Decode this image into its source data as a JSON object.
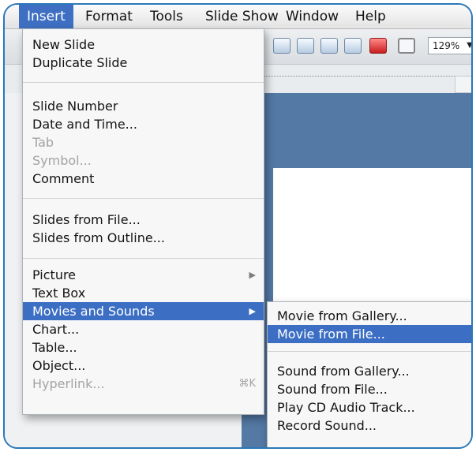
{
  "menubar": {
    "items": [
      "Insert",
      "Format",
      "Tools",
      "Slide Show",
      "Window",
      "Help"
    ]
  },
  "toolbar": {
    "zoom": "129%",
    "icons": [
      "table-icon",
      "chart-icon",
      "image-icon",
      "media-icon",
      "toolbox-icon",
      "textbox-icon"
    ]
  },
  "insert_menu": {
    "items": [
      {
        "label": "New Slide",
        "enabled": true
      },
      {
        "label": "Duplicate Slide",
        "enabled": true
      },
      {
        "label": "Slide Number",
        "enabled": true
      },
      {
        "label": "Date and Time...",
        "enabled": true
      },
      {
        "label": "Tab",
        "enabled": false
      },
      {
        "label": "Symbol...",
        "enabled": false
      },
      {
        "label": "Comment",
        "enabled": true
      },
      {
        "label": "Slides from File...",
        "enabled": true
      },
      {
        "label": "Slides from Outline...",
        "enabled": true
      },
      {
        "label": "Picture",
        "enabled": true,
        "submenu": true
      },
      {
        "label": "Text Box",
        "enabled": true
      },
      {
        "label": "Movies and Sounds",
        "enabled": true,
        "submenu": true,
        "highlighted": true
      },
      {
        "label": "Chart...",
        "enabled": true
      },
      {
        "label": "Table...",
        "enabled": true
      },
      {
        "label": "Object...",
        "enabled": true
      },
      {
        "label": "Hyperlink...",
        "enabled": false,
        "shortcut": "⌘K"
      }
    ]
  },
  "movies_submenu": {
    "items": [
      {
        "label": "Movie from Gallery..."
      },
      {
        "label": "Movie from File...",
        "highlighted": true
      },
      {
        "label": "Sound from Gallery..."
      },
      {
        "label": "Sound from File..."
      },
      {
        "label": "Play CD Audio Track..."
      },
      {
        "label": "Record Sound..."
      }
    ]
  },
  "colors": {
    "highlight": "#3c6fc4",
    "frame": "#2b78b9",
    "workspace": "#5379a4"
  }
}
